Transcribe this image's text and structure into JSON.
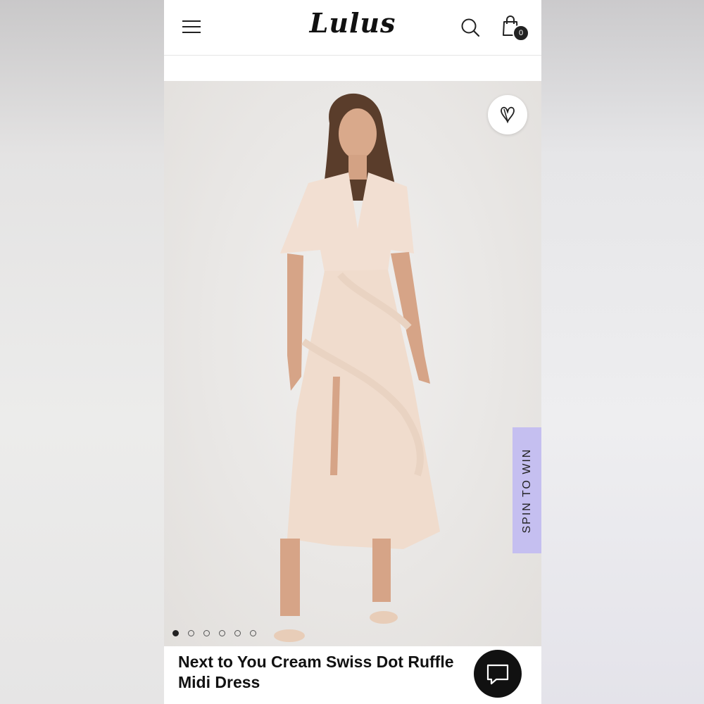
{
  "header": {
    "logo_text": "Lulus",
    "cart_count": "0"
  },
  "product": {
    "title": "Next to You Cream Swiss Dot Ruffle Midi Dress",
    "image_count": 6,
    "active_image": 1
  },
  "promo": {
    "spin_label": "SPIN TO WIN",
    "tab_color": "#c5bff0"
  },
  "icons": {
    "menu": "hamburger-icon",
    "search": "search-icon",
    "bag": "shopping-bag-icon",
    "favorite": "heart-icon",
    "chat": "chat-icon"
  }
}
